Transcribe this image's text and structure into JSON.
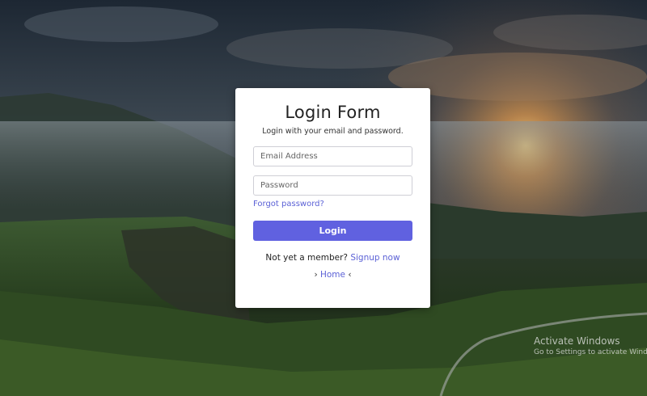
{
  "login": {
    "title": "Login Form",
    "subtitle": "Login with your email and password.",
    "email_placeholder": "Email Address",
    "password_placeholder": "Password",
    "forgot_label": "Forgot password?",
    "submit_label": "Login",
    "member_prompt": "Not yet a member?",
    "signup_label": "Signup now",
    "home_label": "Home",
    "home_left_glyph": "›",
    "home_right_glyph": "‹"
  },
  "watermark": {
    "title": "Activate Windows",
    "subtitle": "Go to Settings to activate Windows."
  },
  "colors": {
    "accent": "#6061e0",
    "link": "#5b61d6",
    "card": "#ffffff"
  }
}
